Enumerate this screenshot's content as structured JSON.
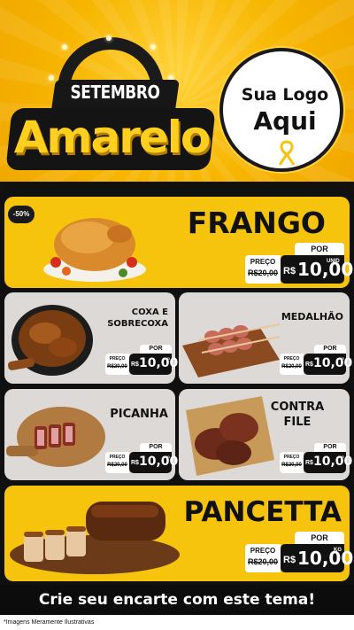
{
  "header": {
    "badge_line1": "SETEMBRO",
    "badge_line2": "Amarelo",
    "logo_line1": "Sua Logo",
    "logo_line2": "Aqui"
  },
  "colors": {
    "yellow": "#f6c30d",
    "dark": "#111111",
    "card_grey": "#ddd9d6"
  },
  "discount_badge": "-50%",
  "products": [
    {
      "name": "FRANGO",
      "image": "roast-chicken",
      "por": "POR",
      "preco_label": "PREÇO",
      "old_price": "R$20,00",
      "currency": "R$",
      "price": "10,00",
      "unit": "UNID"
    },
    {
      "name_line1": "COXA E",
      "name_line2": "SOBRECOXA",
      "image": "chicken-legs-pan",
      "por": "POR",
      "preco_label": "PREÇO",
      "old_price": "R$20,00",
      "currency": "R$",
      "price": "10,00",
      "unit": "KG"
    },
    {
      "name": "MEDALHÃO",
      "image": "medallion-skewers",
      "por": "POR",
      "preco_label": "PREÇO",
      "old_price": "R$20,00",
      "currency": "R$",
      "price": "10,00",
      "unit": "KG"
    },
    {
      "name": "PICANHA",
      "image": "sliced-picanha",
      "por": "POR",
      "preco_label": "PREÇO",
      "old_price": "R$20,00",
      "currency": "R$",
      "price": "10,00",
      "unit": "KG"
    },
    {
      "name_line1": "CONTRA",
      "name_line2": "FILE",
      "image": "steaks-board",
      "por": "POR",
      "preco_label": "PREÇO",
      "old_price": "R$20,00",
      "currency": "R$",
      "price": "10,00",
      "unit": "KG"
    },
    {
      "name": "PANCETTA",
      "image": "roasted-pancetta",
      "por": "POR",
      "preco_label": "PREÇO",
      "old_price": "R$20,00",
      "currency": "R$",
      "price": "10,00",
      "unit": "KG"
    }
  ],
  "cta": "Crie seu encarte com este tema!",
  "disclaimer": "*Imagens Meramente Ilustrativas"
}
